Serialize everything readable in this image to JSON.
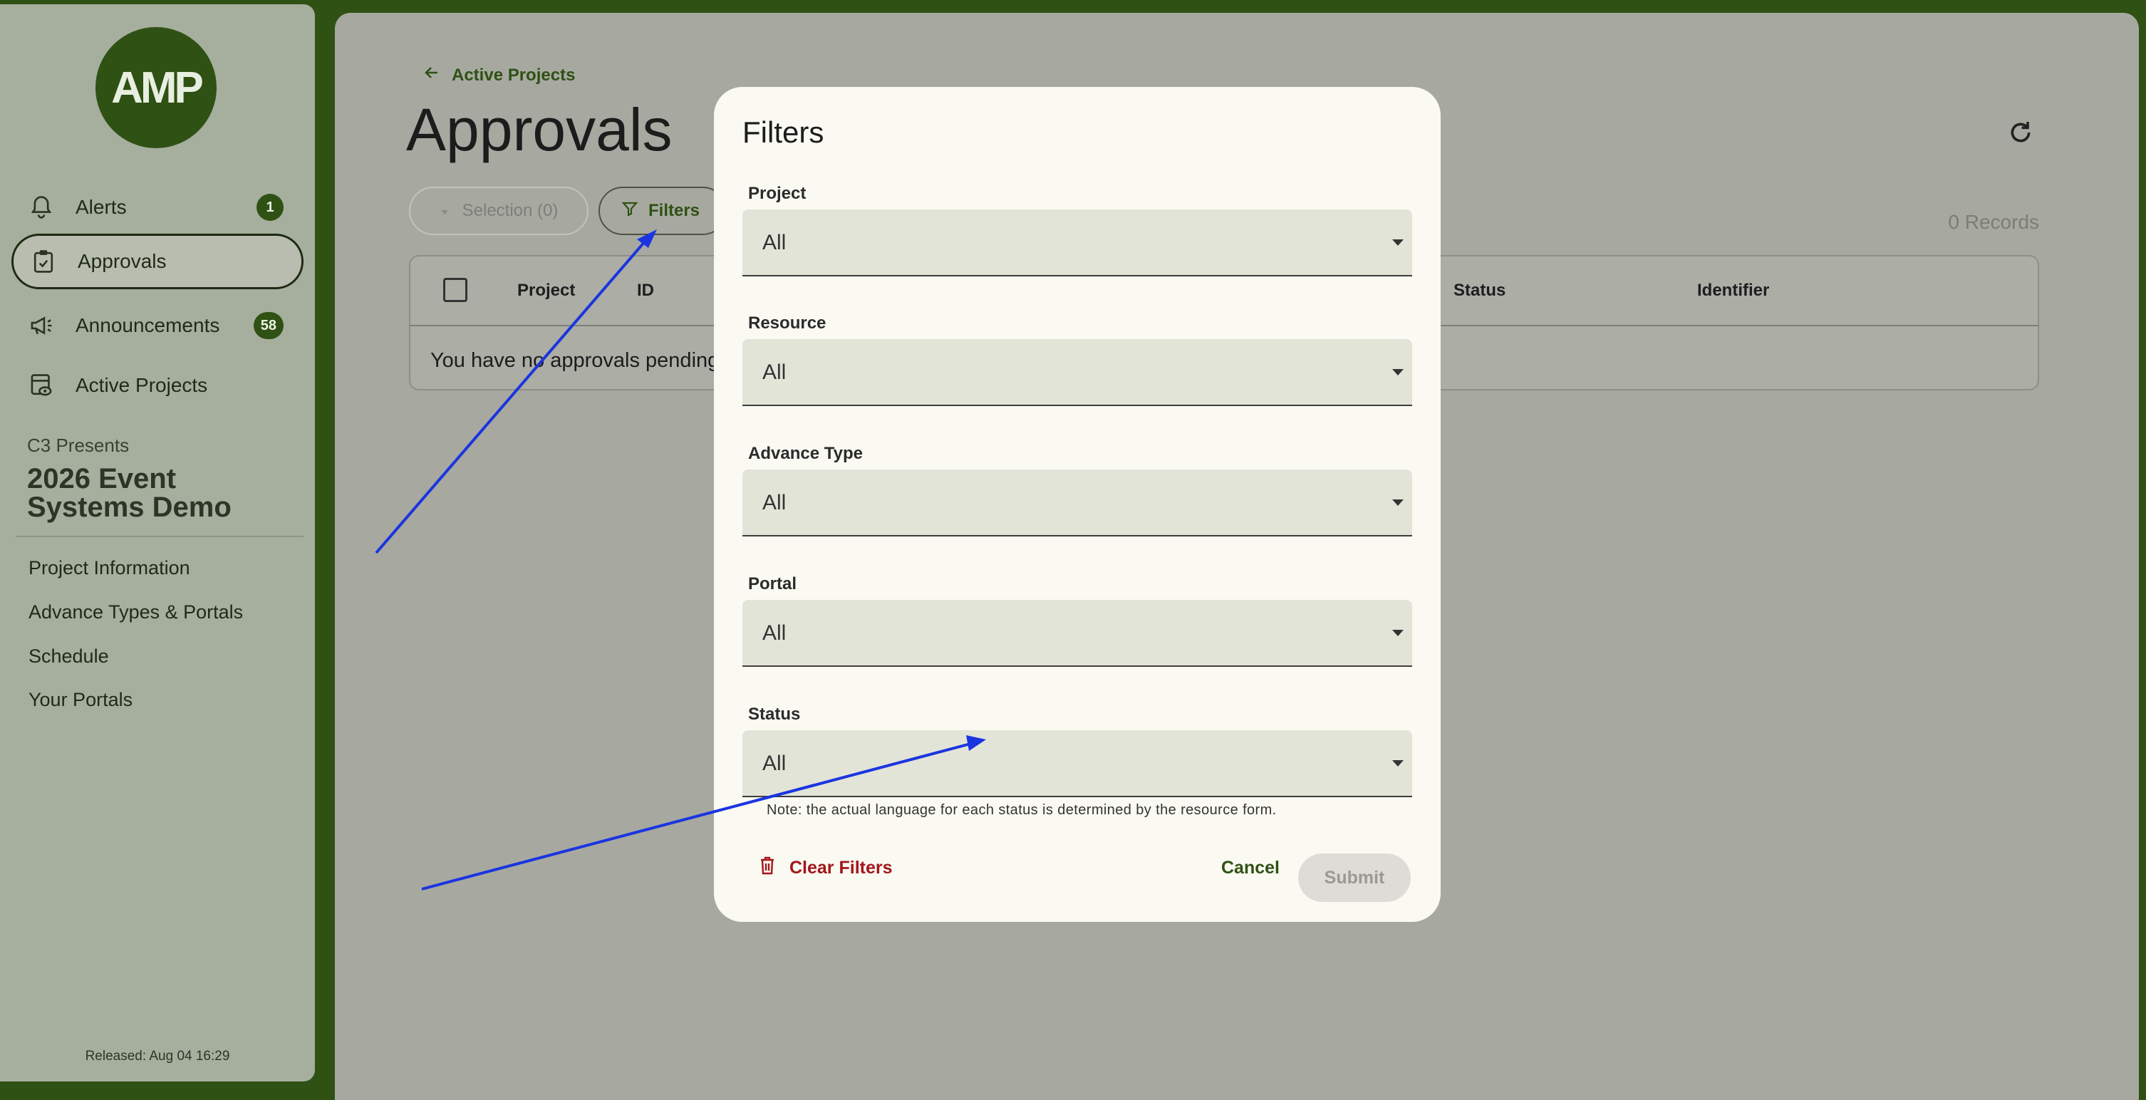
{
  "sidebar": {
    "logo_text": "AMP",
    "nav": [
      {
        "label": "Alerts",
        "badge": "1"
      },
      {
        "label": "Approvals",
        "badge": ""
      },
      {
        "label": "Announcements",
        "badge": "58"
      },
      {
        "label": "Active Projects",
        "badge": ""
      }
    ],
    "org": "C3 Presents",
    "project": "2026 Event Systems Demo",
    "links": [
      "Project Information",
      "Advance Types & Portals",
      "Schedule",
      "Your Portals"
    ],
    "released": "Released: Aug 04 16:29"
  },
  "main": {
    "back_label": "Active Projects",
    "title": "Approvals",
    "selection_label": "Selection (0)",
    "filters_label": "Filters",
    "records": "0 Records",
    "columns": [
      "Project",
      "ID",
      "Status",
      "Identifier"
    ],
    "empty_message": "You have no approvals pending"
  },
  "dialog": {
    "title": "Filters",
    "fields": [
      {
        "label": "Project",
        "value": "All"
      },
      {
        "label": "Resource",
        "value": "All"
      },
      {
        "label": "Advance Type",
        "value": "All"
      },
      {
        "label": "Portal",
        "value": "All"
      },
      {
        "label": "Status",
        "value": "All"
      }
    ],
    "note": "Note: the actual language for each status is determined by the resource form.",
    "clear_label": "Clear Filters",
    "cancel_label": "Cancel",
    "submit_label": "Submit"
  },
  "colors": {
    "brand": "#2f5114",
    "danger": "#a3161b",
    "annotation": "#1a35e0"
  }
}
